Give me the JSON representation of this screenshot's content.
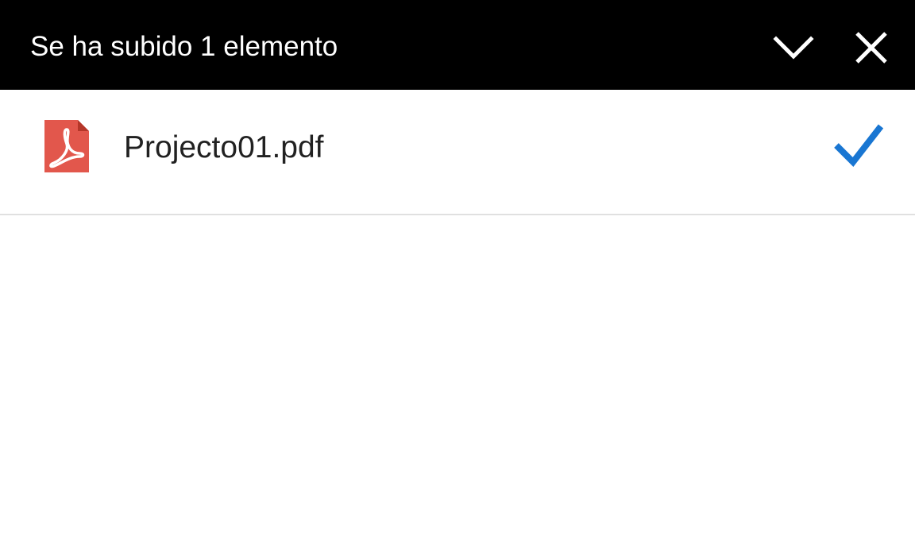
{
  "header": {
    "title": "Se ha subido 1 elemento",
    "background": "#000000",
    "text_color": "#ffffff",
    "collapse_icon": "chevron-down-icon",
    "close_icon": "close-icon"
  },
  "files": [
    {
      "name": "Projecto01.pdf",
      "type_icon": "pdf-file-icon",
      "icon_color": "#e2574c",
      "status_icon": "checkmark-icon",
      "status_color": "#1976d2"
    }
  ]
}
